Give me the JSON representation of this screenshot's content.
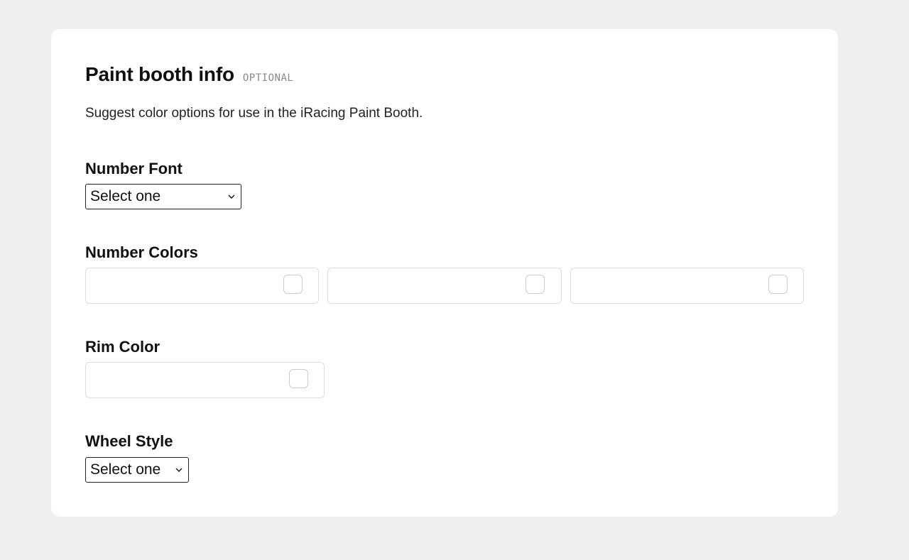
{
  "section": {
    "title": "Paint booth info",
    "badge": "OPTIONAL",
    "description": "Suggest color options for use in the iRacing Paint Booth."
  },
  "number_font": {
    "label": "Number Font",
    "selected": "Select one"
  },
  "number_colors": {
    "label": "Number Colors",
    "inputs": [
      {
        "value": ""
      },
      {
        "value": ""
      },
      {
        "value": ""
      }
    ]
  },
  "rim_color": {
    "label": "Rim Color",
    "value": ""
  },
  "wheel_style": {
    "label": "Wheel Style",
    "selected": "Select one"
  },
  "icons": {
    "select_arrow": "chevron-down-icon",
    "color_swatch": "color-swatch-icon"
  },
  "colors": {
    "page_background": "#efefef",
    "card_background": "#ffffff",
    "input_border": "#dddddd",
    "badge_text": "#888888"
  }
}
